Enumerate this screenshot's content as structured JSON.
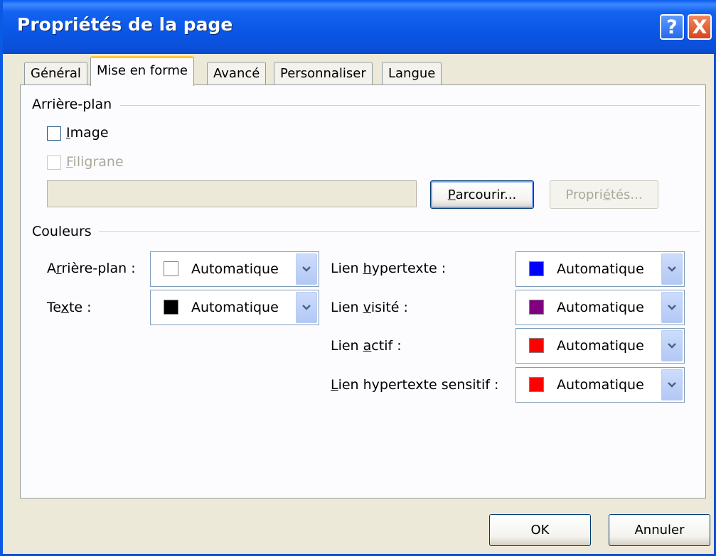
{
  "window": {
    "title": "Propriétés de la page",
    "help": "?",
    "close": "X"
  },
  "tabs": [
    {
      "label": "Général"
    },
    {
      "label": "Mise en forme"
    },
    {
      "label": "Avancé"
    },
    {
      "label": "Personnaliser"
    },
    {
      "label": "Langue"
    }
  ],
  "active_tab": "Mise en forme",
  "background_group": {
    "title": "Arrière-plan",
    "image": {
      "label_first": "I",
      "label_rest": "mage",
      "checked": false
    },
    "watermark": {
      "label_first": "F",
      "label_rest": "iligrane",
      "checked": false,
      "enabled": false
    },
    "path_value": "",
    "browse_button": {
      "pre": "",
      "accel": "P",
      "post": "arcourir..."
    },
    "properties_button": {
      "pre": "Propri",
      "accel": "é",
      "post": "tés..."
    }
  },
  "colors_group": {
    "title": "Couleurs",
    "fields": [
      {
        "pre": "A",
        "accel": "r",
        "post": "rière-plan :",
        "value": "Automatique",
        "color": "#ffffff"
      },
      {
        "pre": "Te",
        "accel": "x",
        "post": "te :",
        "value": "Automatique",
        "color": "#000000"
      },
      {
        "pre": "Lien ",
        "accel": "h",
        "post": "ypertexte :",
        "value": "Automatique",
        "color": "#0000ff"
      },
      {
        "pre": "Lien ",
        "accel": "v",
        "post": "isité :",
        "value": "Automatique",
        "color": "#800080"
      },
      {
        "pre": "Lien ",
        "accel": "a",
        "post": "ctif :",
        "value": "Automatique",
        "color": "#ff0000"
      },
      {
        "pre": "",
        "accel": "L",
        "post": "ien hypertexte sensitif :",
        "value": "Automatique",
        "color": "#ff0000"
      }
    ]
  },
  "footer": {
    "ok": "OK",
    "cancel": "Annuler"
  },
  "icons": {
    "help": "question-mark-icon",
    "close": "close-x-icon",
    "dropdown": "chevron-down-icon"
  }
}
